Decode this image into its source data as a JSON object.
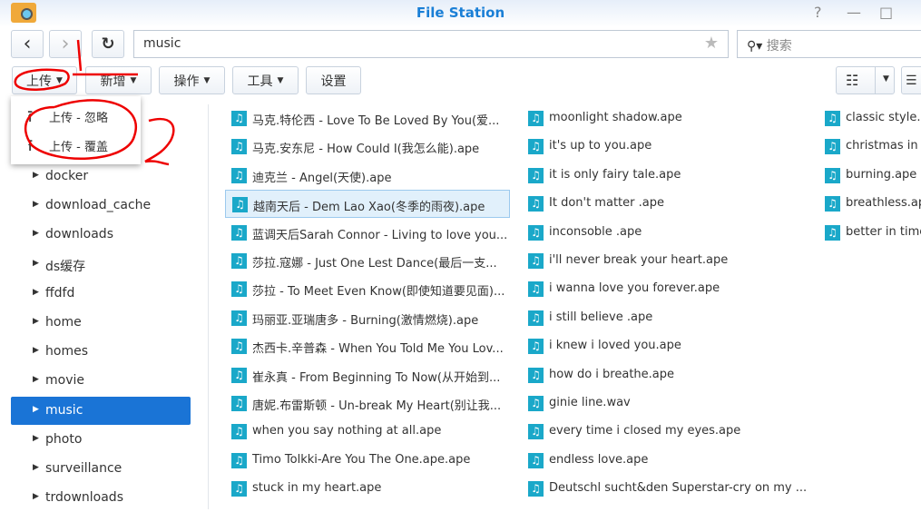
{
  "window": {
    "title": "File Station",
    "help": "?",
    "minimize": "—",
    "maximize": "□"
  },
  "nav": {
    "back": "‹",
    "forward": "›",
    "refresh": "↻",
    "path": "music",
    "star": "★",
    "search_placeholder": "搜索"
  },
  "toolbar": {
    "upload": "上传",
    "create": "新增",
    "action": "操作",
    "tools": "工具",
    "settings": "设置"
  },
  "upload_menu": [
    "上传 - 忽略",
    "上传 - 覆盖"
  ],
  "sidebar": {
    "items": [
      "docker",
      "download_cache",
      "downloads",
      "ds缓存",
      "ffdfd",
      "home",
      "homes",
      "movie",
      "music",
      "photo",
      "surveillance",
      "trdownloads"
    ],
    "selected": "music"
  },
  "files": {
    "col1": [
      "马克.特伦西 - Love To Be Loved By You(爱...",
      "马克.安东尼 - How Could I(我怎么能).ape",
      "迪克兰 - Angel(天使).ape",
      "越南天后 - Dem Lao Xao(冬季的雨夜).ape",
      "蓝调天后Sarah Connor - Living to love you...",
      "莎拉.寇娜 - Just One Lest Dance(最后一支...",
      "莎拉 - To Meet Even Know(即使知道要见面)...",
      "玛丽亚.亚瑞唐多 - Burning(激情燃烧).ape",
      "杰西卡.辛普森 - When You Told Me You Lov...",
      "崔永真 - From Beginning To Now(从开始到...",
      "唐妮.布雷斯顿 - Un-break My Heart(别让我...",
      "when you say nothing at all.ape",
      "Timo Tolkki-Are You The One.ape.ape",
      "stuck in my heart.ape"
    ],
    "col2": [
      "moonlight shadow.ape",
      "it's up to you.ape",
      "it is only fairy tale.ape",
      "It don't matter .ape",
      "inconsoble .ape",
      "i'll never break your heart.ape",
      "i wanna love you forever.ape",
      "i still believe .ape",
      "i knew i loved you.ape",
      "how do i breathe.ape",
      "ginie line.wav",
      "every time i closed my eyes.ape",
      "endless love.ape",
      "Deutschl sucht&den Superstar-cry on my ..."
    ],
    "col3": [
      "classic style.ape",
      "christmas in my heart",
      "burning.ape",
      "breathless.ape",
      "better in time"
    ],
    "selected": "越南天后 - Dem Lao Xao(冬季的雨夜).ape"
  },
  "annotations": {
    "one": "1",
    "two": "2",
    "color": "#e00000"
  },
  "colors": {
    "accent": "#1a74d6",
    "file_icon": "#1aa8c9",
    "title": "#1a7fd6"
  }
}
